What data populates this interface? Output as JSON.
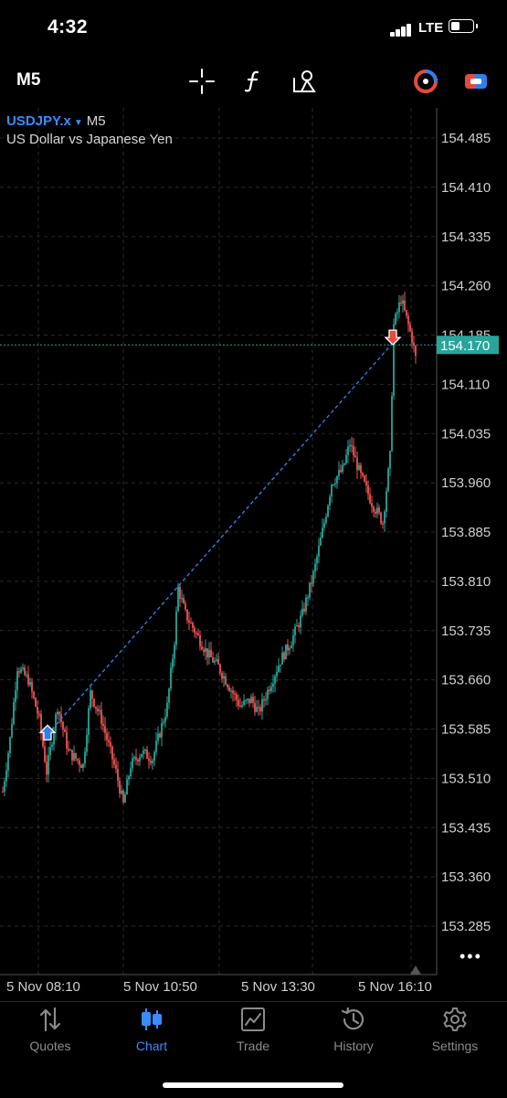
{
  "status_bar": {
    "time": "4:32",
    "network": "LTE"
  },
  "toolbar": {
    "timeframe": "M5",
    "icons": [
      "crosshair-icon",
      "indicators-function-icon",
      "objects-shapes-icon",
      "one-click-trading-icon",
      "trade-levels-icon"
    ]
  },
  "chart": {
    "symbol": "USDJPY.x",
    "timeframe_label": "M5",
    "description": "US Dollar vs Japanese Yen",
    "current_price": "154.170",
    "price_labels": [
      "154.485",
      "154.410",
      "154.335",
      "154.260",
      "154.185",
      "154.110",
      "154.035",
      "153.960",
      "153.885",
      "153.810",
      "153.735",
      "153.660",
      "153.585",
      "153.510",
      "153.435",
      "153.360",
      "153.285"
    ],
    "time_labels": [
      "5 Nov 08:10",
      "5 Nov 10:50",
      "5 Nov 13:30",
      "5 Nov 16:10"
    ],
    "colors": {
      "bull": "#26a69a",
      "bear": "#ef5350",
      "grid": "#2a2a2a",
      "bid_line": "#26a69a",
      "trade_line": "#2f7fe8"
    },
    "trade": {
      "buy_entry_price": 153.577,
      "sell_exit_price": 154.173
    }
  },
  "tabbar": {
    "items": [
      {
        "label": "Quotes",
        "icon": "quotes-arrows-icon"
      },
      {
        "label": "Chart",
        "icon": "chart-candles-icon"
      },
      {
        "label": "Trade",
        "icon": "trade-chart-icon"
      },
      {
        "label": "History",
        "icon": "history-clock-icon"
      },
      {
        "label": "Settings",
        "icon": "settings-gear-icon"
      }
    ],
    "active": "Chart"
  }
}
